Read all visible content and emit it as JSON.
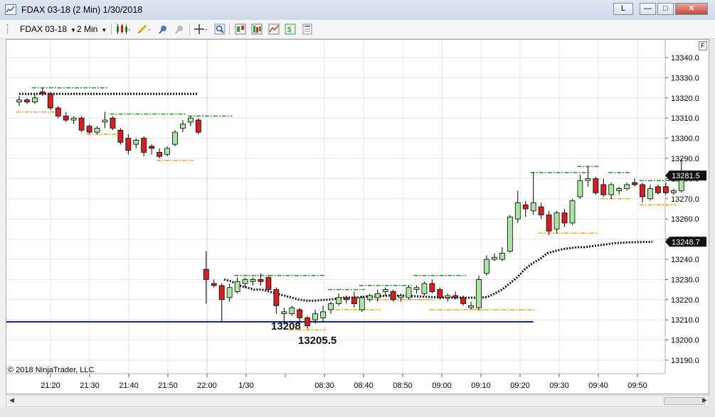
{
  "window": {
    "title": "FDAX 03-18 (2 Min)  1/30/2018",
    "link_button_label": "L",
    "minimize_label": "—",
    "maximize_label": "□",
    "close_label": "✕"
  },
  "toolbar": {
    "instrument_label": "FDAX 03-18",
    "interval_label": "2 Min"
  },
  "chart": {
    "copyright": "© 2018 NinjaTrader, LLC",
    "panel_label": "F",
    "colors": {
      "up_fill": "#a8e6a1",
      "down_fill": "#d81e1e",
      "resistance": "#2e8b2e",
      "support": "#f0a020",
      "vwap": "#111111",
      "horizontal_line": "#1a237e",
      "grid": "#e6e6e6"
    },
    "annotations": [
      {
        "text": "13208",
        "price": 13208
      },
      {
        "text": "13205.5",
        "price": 13205.5
      }
    ],
    "price_markers": [
      {
        "text": "13281.5",
        "price": 13281.5
      },
      {
        "text": "13248.7",
        "price": 13248.7
      }
    ]
  },
  "chart_data": {
    "type": "candlestick",
    "instrument": "FDAX 03-18",
    "interval": "2 Min",
    "date": "1/30/2018",
    "y_ticks": [
      13190.0,
      13200.0,
      13210.0,
      13220.0,
      13230.0,
      13240.0,
      13250.0,
      13260.0,
      13270.0,
      13280.0,
      13290.0,
      13300.0,
      13310.0,
      13320.0,
      13330.0,
      13340.0
    ],
    "ylim": [
      13185,
      13346
    ],
    "x_ticks": [
      "21:20",
      "21:30",
      "21:40",
      "21:50",
      "22:00",
      "1/30",
      "08:30",
      "08:40",
      "08:50",
      "09:00",
      "09:10",
      "09:20",
      "09:30",
      "09:40",
      "09:50"
    ],
    "grid": true,
    "candles": [
      {
        "o": 13318,
        "h": 13321,
        "l": 13316,
        "c": 13319
      },
      {
        "o": 13319,
        "h": 13320,
        "l": 13317,
        "c": 13318
      },
      {
        "o": 13318,
        "h": 13322,
        "l": 13317,
        "c": 13320
      },
      {
        "o": 13323,
        "h": 13325,
        "l": 13321,
        "c": 13322
      },
      {
        "o": 13322,
        "h": 13323,
        "l": 13314,
        "c": 13315
      },
      {
        "o": 13315,
        "h": 13316,
        "l": 13310,
        "c": 13311
      },
      {
        "o": 13311,
        "h": 13313,
        "l": 13308,
        "c": 13309
      },
      {
        "o": 13309,
        "h": 13311,
        "l": 13307,
        "c": 13310
      },
      {
        "o": 13310,
        "h": 13311,
        "l": 13303,
        "c": 13304
      },
      {
        "o": 13306,
        "h": 13307,
        "l": 13302,
        "c": 13303
      },
      {
        "o": 13303,
        "h": 13306,
        "l": 13302,
        "c": 13305
      },
      {
        "o": 13308,
        "h": 13313,
        "l": 13305,
        "c": 13309
      },
      {
        "o": 13310,
        "h": 13311,
        "l": 13304,
        "c": 13305
      },
      {
        "o": 13304,
        "h": 13305,
        "l": 13297,
        "c": 13298
      },
      {
        "o": 13300,
        "h": 13302,
        "l": 13292,
        "c": 13294
      },
      {
        "o": 13297,
        "h": 13300,
        "l": 13295,
        "c": 13299
      },
      {
        "o": 13300,
        "h": 13301,
        "l": 13291,
        "c": 13293
      },
      {
        "o": 13296,
        "h": 13297,
        "l": 13292,
        "c": 13295
      },
      {
        "o": 13293,
        "h": 13295,
        "l": 13290,
        "c": 13291
      },
      {
        "o": 13292,
        "h": 13296,
        "l": 13291,
        "c": 13295
      },
      {
        "o": 13297,
        "h": 13304,
        "l": 13296,
        "c": 13303
      },
      {
        "o": 13305,
        "h": 13309,
        "l": 13303,
        "c": 13307
      },
      {
        "o": 13308,
        "h": 13311,
        "l": 13306,
        "c": 13310
      },
      {
        "o": 13309,
        "h": 13310,
        "l": 13302,
        "c": 13303
      },
      {
        "o": 13235,
        "h": 13244,
        "l": 13218,
        "c": 13230
      },
      {
        "o": 13228,
        "h": 13230,
        "l": 13226,
        "c": 13227
      },
      {
        "o": 13227,
        "h": 13228,
        "l": 13209,
        "c": 13220
      },
      {
        "o": 13221,
        "h": 13228,
        "l": 13219,
        "c": 13226
      },
      {
        "o": 13224,
        "h": 13231,
        "l": 13223,
        "c": 13229
      },
      {
        "o": 13228,
        "h": 13231,
        "l": 13226,
        "c": 13230
      },
      {
        "o": 13229,
        "h": 13231,
        "l": 13227,
        "c": 13230
      },
      {
        "o": 13230,
        "h": 13233,
        "l": 13227,
        "c": 13229
      },
      {
        "o": 13231,
        "h": 13232,
        "l": 13224,
        "c": 13225
      },
      {
        "o": 13225,
        "h": 13226,
        "l": 13213,
        "c": 13217
      },
      {
        "o": 13213,
        "h": 13216,
        "l": 13208,
        "c": 13214
      },
      {
        "o": 13213,
        "h": 13217,
        "l": 13212,
        "c": 13216
      },
      {
        "o": 13215,
        "h": 13216,
        "l": 13208,
        "c": 13211
      },
      {
        "o": 13211,
        "h": 13212,
        "l": 13205.5,
        "c": 13207
      },
      {
        "o": 13210,
        "h": 13215,
        "l": 13208,
        "c": 13213
      },
      {
        "o": 13211,
        "h": 13217,
        "l": 13209,
        "c": 13214
      },
      {
        "o": 13215,
        "h": 13219,
        "l": 13213,
        "c": 13218
      },
      {
        "o": 13218,
        "h": 13223,
        "l": 13217,
        "c": 13221
      },
      {
        "o": 13221,
        "h": 13222,
        "l": 13218,
        "c": 13220
      },
      {
        "o": 13221,
        "h": 13224,
        "l": 13216,
        "c": 13218
      },
      {
        "o": 13215,
        "h": 13222,
        "l": 13214,
        "c": 13221
      },
      {
        "o": 13220,
        "h": 13223,
        "l": 13219,
        "c": 13222
      },
      {
        "o": 13221,
        "h": 13225,
        "l": 13219,
        "c": 13223
      },
      {
        "o": 13224,
        "h": 13226,
        "l": 13222,
        "c": 13225
      },
      {
        "o": 13224,
        "h": 13225,
        "l": 13219,
        "c": 13220
      },
      {
        "o": 13221,
        "h": 13223,
        "l": 13219,
        "c": 13222
      },
      {
        "o": 13221,
        "h": 13227,
        "l": 13220,
        "c": 13226
      },
      {
        "o": 13225,
        "h": 13227,
        "l": 13223,
        "c": 13226
      },
      {
        "o": 13223,
        "h": 13229,
        "l": 13222,
        "c": 13228
      },
      {
        "o": 13228,
        "h": 13230,
        "l": 13223,
        "c": 13224
      },
      {
        "o": 13225,
        "h": 13226,
        "l": 13220,
        "c": 13221
      },
      {
        "o": 13221,
        "h": 13223,
        "l": 13219,
        "c": 13222
      },
      {
        "o": 13222,
        "h": 13224,
        "l": 13220,
        "c": 13221
      },
      {
        "o": 13221,
        "h": 13222,
        "l": 13217,
        "c": 13218
      },
      {
        "o": 13216,
        "h": 13219,
        "l": 13215,
        "c": 13217
      },
      {
        "o": 13216,
        "h": 13232,
        "l": 13215,
        "c": 13230
      },
      {
        "o": 13233,
        "h": 13242,
        "l": 13232,
        "c": 13240
      },
      {
        "o": 13240,
        "h": 13243,
        "l": 13239,
        "c": 13241
      },
      {
        "o": 13240,
        "h": 13246,
        "l": 13239,
        "c": 13243
      },
      {
        "o": 13244,
        "h": 13262,
        "l": 13243,
        "c": 13261
      },
      {
        "o": 13260,
        "h": 13274,
        "l": 13258,
        "c": 13268
      },
      {
        "o": 13267,
        "h": 13269,
        "l": 13261,
        "c": 13265
      },
      {
        "o": 13264,
        "h": 13283,
        "l": 13262,
        "c": 13268
      },
      {
        "o": 13266,
        "h": 13268,
        "l": 13260,
        "c": 13262
      },
      {
        "o": 13262,
        "h": 13264,
        "l": 13252,
        "c": 13254
      },
      {
        "o": 13255,
        "h": 13264,
        "l": 13253,
        "c": 13263
      },
      {
        "o": 13263,
        "h": 13265,
        "l": 13256,
        "c": 13258
      },
      {
        "o": 13258,
        "h": 13270,
        "l": 13257,
        "c": 13269
      },
      {
        "o": 13271,
        "h": 13282,
        "l": 13270,
        "c": 13279
      },
      {
        "o": 13279,
        "h": 13286,
        "l": 13276,
        "c": 13280
      },
      {
        "o": 13280,
        "h": 13281,
        "l": 13272,
        "c": 13273
      },
      {
        "o": 13277,
        "h": 13280,
        "l": 13271,
        "c": 13272
      },
      {
        "o": 13272,
        "h": 13278,
        "l": 13270,
        "c": 13277
      },
      {
        "o": 13274,
        "h": 13276,
        "l": 13272,
        "c": 13275
      },
      {
        "o": 13275,
        "h": 13278,
        "l": 13274,
        "c": 13277
      },
      {
        "o": 13278,
        "h": 13280,
        "l": 13276,
        "c": 13277
      },
      {
        "o": 13277,
        "h": 13278,
        "l": 13268,
        "c": 13271
      },
      {
        "o": 13270,
        "h": 13277,
        "l": 13269,
        "c": 13275
      },
      {
        "o": 13276,
        "h": 13277,
        "l": 13272,
        "c": 13273
      },
      {
        "o": 13276,
        "h": 13278,
        "l": 13272,
        "c": 13273
      },
      {
        "o": 13273,
        "h": 13275,
        "l": 13272,
        "c": 13274
      },
      {
        "o": 13274,
        "h": 13290,
        "l": 13273,
        "c": 13281.5
      }
    ],
    "resistance_segments": [
      {
        "start": 2,
        "end": 11,
        "price": 13325
      },
      {
        "start": 12,
        "end": 21,
        "price": 13312
      },
      {
        "start": 22,
        "end": 27,
        "price": 13311
      },
      {
        "start": 28,
        "end": 39,
        "price": 13232
      },
      {
        "start": 40,
        "end": 44,
        "price": 13225
      },
      {
        "start": 44,
        "end": 50,
        "price": 13227
      },
      {
        "start": 51,
        "end": 57,
        "price": 13232
      },
      {
        "start": 66,
        "end": 73,
        "price": 13283
      },
      {
        "start": 72,
        "end": 74,
        "price": 13286
      },
      {
        "start": 76,
        "end": 78,
        "price": 13283
      },
      {
        "start": 80,
        "end": 84,
        "price": 13279
      }
    ],
    "support_segments": [
      {
        "start": 0,
        "end": 5,
        "price": 13313
      },
      {
        "start": 9,
        "end": 13,
        "price": 13302
      },
      {
        "start": 18,
        "end": 22,
        "price": 13289
      },
      {
        "start": 35,
        "end": 39,
        "price": 13205
      },
      {
        "start": 41,
        "end": 46,
        "price": 13215
      },
      {
        "start": 46,
        "end": 53,
        "price": 13220
      },
      {
        "start": 53,
        "end": 59,
        "price": 13215
      },
      {
        "start": 59,
        "end": 66,
        "price": 13215
      },
      {
        "start": 67,
        "end": 74,
        "price": 13253
      },
      {
        "start": 75,
        "end": 78,
        "price": 13270
      },
      {
        "start": 80,
        "end": 84,
        "price": 13267
      }
    ],
    "pre_session_vwap": {
      "start": 0,
      "end": 23,
      "price": 13322
    },
    "session_vwap": [
      13230,
      13229,
      13227,
      13226,
      13225,
      13225,
      13224,
      13223,
      13222,
      13221,
      13220,
      13219.5,
      13219.5,
      13219.8,
      13220,
      13220.5,
      13221,
      13221,
      13221.2,
      13221.5,
      13221.6,
      13221.8,
      13222,
      13222,
      13222,
      13221.8,
      13221.6,
      13221.4,
      13221.2,
      13221,
      13221,
      13221,
      13221,
      13221,
      13221,
      13221.2,
      13223,
      13225,
      13228,
      13231,
      13235,
      13238,
      13240,
      13243,
      13244,
      13245,
      13245.5,
      13246,
      13246,
      13246.5,
      13247,
      13247.5,
      13248,
      13248.2,
      13248.4,
      13248.5,
      13248.6,
      13248.7
    ],
    "horizontal_line": {
      "start": 0,
      "end": 66,
      "price": 13209
    }
  }
}
